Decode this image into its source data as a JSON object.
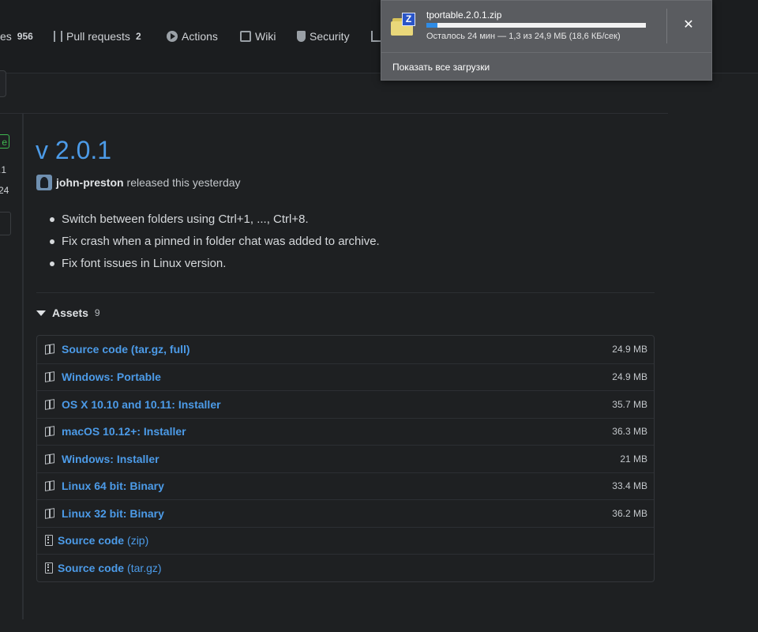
{
  "nav": {
    "issues_fragment": "es",
    "issues_count": "956",
    "pull_requests": {
      "label": "Pull requests",
      "count": "2"
    },
    "actions": "Actions",
    "wiki": "Wiki",
    "security": "Security"
  },
  "sidebar": {
    "badge": "e",
    "tag_fragment": ".1",
    "date_fragment": "24"
  },
  "release": {
    "title": "v 2.0.1",
    "author": "john-preston",
    "released_text": "released this yesterday",
    "notes": [
      "Switch between folders using Ctrl+1, ..., Ctrl+8.",
      "Fix crash when a pinned in folder chat was added to archive.",
      "Fix font issues in Linux version."
    ]
  },
  "assets": {
    "label": "Assets",
    "count": "9",
    "items": [
      {
        "name": "Source code (tar.gz, full)",
        "size": "24.9 MB",
        "icon": "package-icon"
      },
      {
        "name": "Windows: Portable",
        "size": "24.9 MB",
        "icon": "package-icon"
      },
      {
        "name": "OS X 10.10 and 10.11: Installer",
        "size": "35.7 MB",
        "icon": "package-icon"
      },
      {
        "name": "macOS 10.12+: Installer",
        "size": "36.3 MB",
        "icon": "package-icon"
      },
      {
        "name": "Windows: Installer",
        "size": "21 MB",
        "icon": "package-icon"
      },
      {
        "name": "Linux 64 bit: Binary",
        "size": "33.4 MB",
        "icon": "package-icon"
      },
      {
        "name": "Linux 32 bit: Binary",
        "size": "36.2 MB",
        "icon": "package-icon"
      }
    ],
    "sources": [
      {
        "name": "Source code",
        "suffix": "(zip)",
        "icon": "zip-file-icon"
      },
      {
        "name": "Source code",
        "suffix": "(tar.gz)",
        "icon": "zip-file-icon"
      }
    ]
  },
  "download": {
    "filename": "tportable.2.0.1.zip",
    "progress_fraction": 0.05,
    "status": "Осталось 24 мин — 1,3 из 24,9 МБ (18,6 КБ/сек)",
    "close_symbol": "✕",
    "show_all": "Показать все загрузки",
    "archive_badge": "Z"
  },
  "colors": {
    "link": "#4c9be8",
    "background": "#1e2022",
    "progress": "#2f8ce6",
    "popup_bg": "#5a5c60"
  }
}
